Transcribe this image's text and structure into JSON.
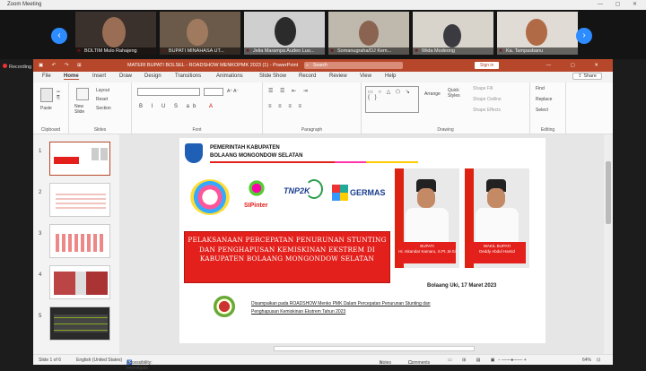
{
  "zoom": {
    "title": "Zoom Meeting",
    "recording": "Recording",
    "participants": [
      {
        "name": "BOLTIM Mulo Rahajeng"
      },
      {
        "name": "BUPATI MINAHASA UT..."
      },
      {
        "name": "Jelia Marampa Audeo Luo..."
      },
      {
        "name": "Somanugraha/DJ Kem..."
      },
      {
        "name": "Wida Modeong"
      },
      {
        "name": "Ka. Tampasbanu"
      }
    ]
  },
  "ppt": {
    "title": "MATERI BUPATI BOLSEL - ROADSHOW MENKOPMK 2023 (1) -  PowerPoint",
    "search": "Search",
    "signin": "Sign in",
    "tabs": [
      "File",
      "Home",
      "Insert",
      "Draw",
      "Design",
      "Transitions",
      "Animations",
      "Slide Show",
      "Record",
      "Review",
      "View",
      "Help"
    ],
    "share": "Share",
    "groups": {
      "clipboard": "Clipboard",
      "slides": "Slides",
      "font": "Font",
      "paragraph": "Paragraph",
      "drawing": "Drawing",
      "editing": "Editing"
    },
    "ribbon": {
      "paste": "Paste",
      "new_slide": "New Slide",
      "layout": "Layout",
      "reset": "Reset",
      "section": "Section",
      "arrange": "Arrange",
      "quick_styles": "Quick Styles",
      "shape_fill": "Shape Fill",
      "shape_outline": "Shape Outline",
      "shape_effects": "Shape Effects",
      "find": "Find",
      "replace": "Replace",
      "select": "Select"
    },
    "slide_numbers": [
      "1",
      "2",
      "3",
      "4",
      "5"
    ],
    "status": {
      "slide_of": "Slide 1 of 6",
      "language": "English (United States)",
      "accessibility": "Accessibility: Investigate",
      "notes": "Notes",
      "comments": "Comments",
      "zoom": "64%"
    }
  },
  "slide": {
    "header_line1": "PEMERINTAH KABUPATEN",
    "header_line2": "BOLAANG MONGONDOW SELATAN",
    "logo_sipinter": "SIPinter",
    "logo_tnp2k": "TNP2K",
    "logo_germas": "GERMAS",
    "title": "PELAKSANAAN PERCEPATAN PENURUNAN STUNTING DAN PENGHAPUSAN KEMISKINAN EKSTREM DI KABUPATEN BOLAANG MONGONDOW SELATAN",
    "bupati_role": "BUPATI",
    "bupati_name": "Hi. Iskandar Kamaru, S.Pt.,M.Si",
    "wakil_role": "WAKIL BUPATI",
    "wakil_name": "Deddy Abdul Hamid",
    "place_date": "Bolaang Uki, 17 Maret 2023",
    "footer_line1": "Disampaikan pada ROADSHOW Menko PMK Dalam Percepatan Penurunan Stunting dan",
    "footer_line2": "Penghapusan Kemiskinan Ekstrem Tahun 2023"
  },
  "colors": {
    "ppt_accent": "#b7472a",
    "slide_red": "#e3201b",
    "zoom_blue": "#2d8cff"
  }
}
